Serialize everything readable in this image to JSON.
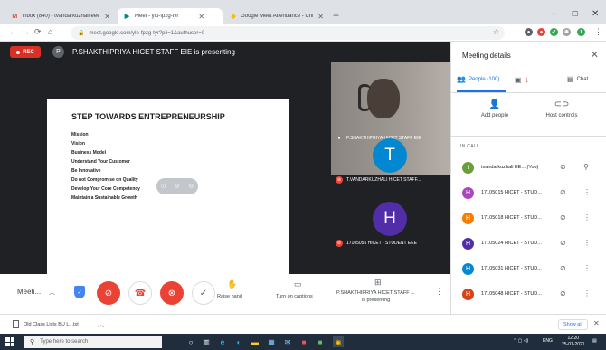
{
  "browser": {
    "tabs": [
      {
        "label": "Inbox (840) - tvandarkuzhali.eee...",
        "favicon": "gmail-icon",
        "active": false
      },
      {
        "label": "Meet - ylo-fpzg-tyr",
        "favicon": "meet-icon",
        "active": true
      },
      {
        "label": "Google Meet Attendance - Chro...",
        "favicon": "chrome-web-store-icon",
        "active": false
      }
    ],
    "url": "meet.google.com/ylo-fpzg-tyr?pli=1&authuser=0"
  },
  "meet": {
    "rec_label": "REC",
    "presenter_initial": "P",
    "presenting_text": "P.SHAKTHIPRIYA HICET STAFF EIE is presenting",
    "slide": {
      "title": "STEP TOWARDS ENTREPRENEURSHIP",
      "lines": [
        "Mission",
        "Vision",
        "Business Model",
        "Understand Your Customer",
        "Be Innovative",
        "Do not Compromise on Quality",
        "Develop Your Core Competency",
        "Maintain a Sustainable Growth"
      ]
    },
    "tiles": [
      {
        "name": "P.SHAKTHIPRIYA HICET STAFF EIE",
        "initial": ""
      },
      {
        "name": "T.VANDARKUZHALI HICET STAFF...",
        "initial": "T",
        "color": "#0288d1"
      },
      {
        "name": "17105055 HICET - STUDENT EEE",
        "initial": "H",
        "color": "#512da8"
      }
    ]
  },
  "controls": {
    "meeting_label": "Meeti...",
    "raise_hand": "Raise hand",
    "captions": "Turn on captions",
    "presenting_label_1": "P.SHAKTHIPRIYA HICET STAFF ...",
    "presenting_label_2": "is presenting"
  },
  "panel": {
    "title": "Meeting details",
    "tabs": {
      "people": "People (100)",
      "chat": "Chat"
    },
    "add_people": "Add people",
    "host_controls": "Host controls",
    "in_call": "IN CALL",
    "people": [
      {
        "initial": "t",
        "name": "tvandarkuzhali EE... (You)",
        "color": "#689f38"
      },
      {
        "initial": "H",
        "name": "17105015 HICET - STUD...",
        "color": "#ab47bc"
      },
      {
        "initial": "H",
        "name": "17105018 HICET - STUD...",
        "color": "#f57c00"
      },
      {
        "initial": "H",
        "name": "17105024 HICET - STUD...",
        "color": "#512da8"
      },
      {
        "initial": "H",
        "name": "17105031 HICET - STUD...",
        "color": "#0288d1"
      },
      {
        "initial": "H",
        "name": "17105048 HICET - STUD...",
        "color": "#d84315"
      }
    ]
  },
  "downloads": {
    "file": "Old Class Lists BU L...txt",
    "show_all": "Show all"
  },
  "taskbar": {
    "search_placeholder": "Type here to search",
    "lang": "ENG",
    "time": "12:20",
    "date": "25-01-2021"
  }
}
